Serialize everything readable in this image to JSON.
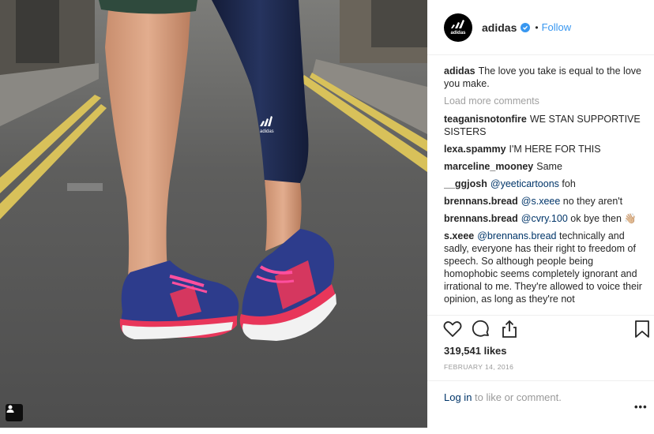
{
  "post": {
    "account": {
      "avatar_logo": "adidas",
      "username": "adidas",
      "verified": true,
      "separator": "•",
      "follow_label": "Follow"
    },
    "photo": {
      "description_icon": "sneakers-photo",
      "leggings_logo": "adidas",
      "tag_icon": "user-tag-icon"
    },
    "caption": {
      "user": "adidas",
      "text": "The love you take is equal to the love you make."
    },
    "load_more_label": "Load more comments",
    "comments": [
      {
        "user": "teaganisnotonfire",
        "text": "WE STAN SUPPORTIVE SISTERS"
      },
      {
        "user": "lexa.spammy",
        "text": "I'M HERE FOR THIS"
      },
      {
        "user": "marceline_mooney",
        "text": "Same"
      },
      {
        "user": "__ggjosh",
        "mention": "@yeeticartoons",
        "text": "foh"
      },
      {
        "user": "brennans.bread",
        "mention": "@s.xeee",
        "text": "no they aren't"
      },
      {
        "user": "brennans.bread",
        "mention": "@cvry.100",
        "text": "ok bye then 👋🏼"
      },
      {
        "user": "s.xeee",
        "mention": "@brennans.bread",
        "text": "technically and sadly, everyone has their right to freedom of speech. So although people being homophobic seems completely ignorant and irrational to me. They're allowed to voice their opinion, as long as they're not"
      }
    ],
    "actions": {
      "like_icon": "heart-icon",
      "comment_icon": "comment-icon",
      "share_icon": "share-icon",
      "save_icon": "bookmark-icon"
    },
    "likes": "319,541 likes",
    "date": "FEBRUARY 14, 2016",
    "login_link": "Log in",
    "login_suffix": "to like or comment.",
    "more_options": "•••"
  },
  "colors": {
    "link": "#003569",
    "follow": "#3897f0",
    "muted": "#999999",
    "shoe_blue": "#2d3c8c",
    "shoe_pink": "#e8365a",
    "leggings": "#1e2a4f"
  }
}
